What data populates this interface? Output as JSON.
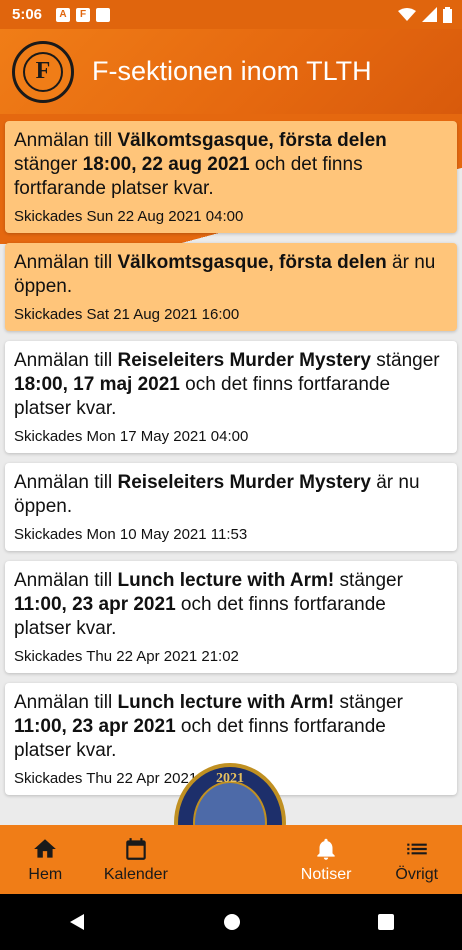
{
  "status_bar": {
    "time": "5:06"
  },
  "header": {
    "title": "F-sektionen inom TLTH"
  },
  "notifications": [
    {
      "highlight": true,
      "pre": "Anmälan till ",
      "event": "Välkomtsgasque, första delen",
      "mid": " stänger ",
      "deadline": "18:00, 22 aug 2021",
      "post": " och det finns fortfarande platser kvar.",
      "sent": "Skickades Sun 22 Aug 2021 04:00"
    },
    {
      "highlight": true,
      "pre": "Anmälan till ",
      "event": "Välkomtsgasque, första delen",
      "mid": " är nu öppen.",
      "deadline": "",
      "post": "",
      "sent": "Skickades Sat 21 Aug 2021 16:00"
    },
    {
      "highlight": false,
      "pre": "Anmälan till ",
      "event": "Reiseleiters Murder Mystery",
      "mid": " stänger ",
      "deadline": "18:00, 17 maj 2021",
      "post": " och det finns fortfarande platser kvar.",
      "sent": "Skickades Mon 17 May 2021 04:00"
    },
    {
      "highlight": false,
      "pre": "Anmälan till ",
      "event": "Reiseleiters Murder Mystery",
      "mid": " är nu öppen.",
      "deadline": "",
      "post": "",
      "sent": "Skickades Mon 10 May 2021 11:53"
    },
    {
      "highlight": false,
      "pre": "Anmälan till ",
      "event": "Lunch lecture with Arm!",
      "mid": " stänger ",
      "deadline": "11:00, 23 apr 2021",
      "post": " och det finns fortfarande platser kvar.",
      "sent": "Skickades Thu 22 Apr 2021 21:02"
    },
    {
      "highlight": false,
      "pre": "Anmälan till ",
      "event": "Lunch lecture with Arm!",
      "mid": " stänger ",
      "deadline": "11:00, 23 apr 2021",
      "post": " och det finns fortfarande platser kvar.",
      "sent": "Skickades Thu 22 Apr 2021 21:02"
    }
  ],
  "bottom_nav": {
    "home": "Hem",
    "calendar": "Kalender",
    "notifications": "Notiser",
    "other": "Övrigt",
    "active": "notifications"
  },
  "badge": {
    "year": "2021"
  },
  "colors": {
    "brand": "#f07d17",
    "highlight_card": "#ffc57a"
  }
}
